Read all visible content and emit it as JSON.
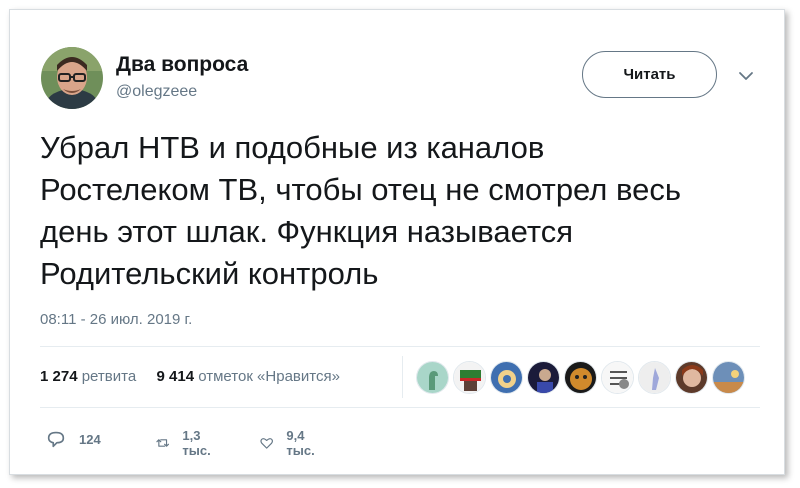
{
  "author": {
    "name": "Два вопроса",
    "handle": "@olegzeee"
  },
  "follow_button": "Читать",
  "tweet": {
    "lines": [
      "Убрал НТВ и подобные из каналов",
      "Ростелеком ТВ, чтобы отец не смотрел весь",
      "день этот шлак. Функция называется",
      "Родительский контроль"
    ],
    "timestamp": "08:11 - 26 июл. 2019 г."
  },
  "stats": {
    "retweets_count": "1 274",
    "retweets_label": "ретвита",
    "likes_count": "9 414",
    "likes_label": "отметок «Нравится»"
  },
  "actions": {
    "reply_count": "124",
    "retweet_count": "1,3 тыс.",
    "like_count": "9,4 тыс."
  },
  "colors": {
    "text": "#14171a",
    "muted": "#657786",
    "divider": "#e6ecf0"
  }
}
